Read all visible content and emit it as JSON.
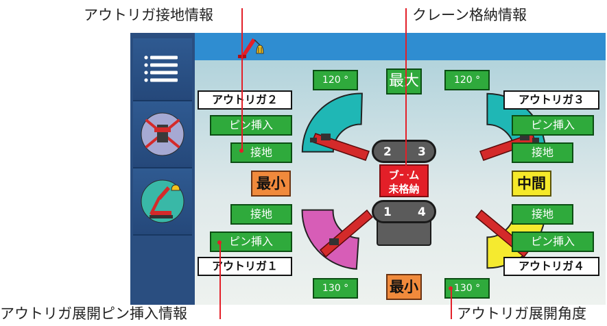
{
  "callouts": {
    "outrigger_ground_info": "アウトリガ接地情報",
    "crane_storage_info": "クレーン格納情報",
    "outrigger_pin_info": "アウトリガ展開ピン挿入情報",
    "outrigger_angle": "アウトリガ展開角度"
  },
  "colors": {
    "accent_blue": "#2f8dd1",
    "sidebar": "#2a4e80",
    "status_green": "#2faa3c",
    "warning_red": "#e31f28",
    "cyan_sector": "#1fb7b5",
    "magenta_sector": "#d75db7",
    "yellow_sector": "#f5ea2f"
  },
  "sidebar": {
    "items": [
      {
        "icon": "menu-icon"
      },
      {
        "icon": "outrigger-view-icon"
      },
      {
        "icon": "crane-view-icon"
      }
    ]
  },
  "topbar": {
    "icon": "crane-hook-icon"
  },
  "outriggers": {
    "o1": {
      "label": "アウトリガ１",
      "pin": "ピン挿入",
      "ground": "接地",
      "angle": "130 °",
      "extension": "最小"
    },
    "o2": {
      "label": "アウトリガ２",
      "pin": "ピン挿入",
      "ground": "接地",
      "angle": "120 °",
      "extension": "最小"
    },
    "o3": {
      "label": "アウトリガ３",
      "pin": "ピン挿入",
      "ground": "接地",
      "angle": "120 °",
      "extension": "中間"
    },
    "o4": {
      "label": "アウトリガ４",
      "pin": "ピン挿入",
      "ground": "接地",
      "angle": "130 °",
      "extension": "中間"
    }
  },
  "top_extension": "最大",
  "bottom_extension": "最小",
  "pills": {
    "top_left": "2",
    "top_right": "3",
    "bottom_left": "1",
    "bottom_right": "4"
  },
  "boom": {
    "line1": "ブーム",
    "line2": "未格納"
  }
}
